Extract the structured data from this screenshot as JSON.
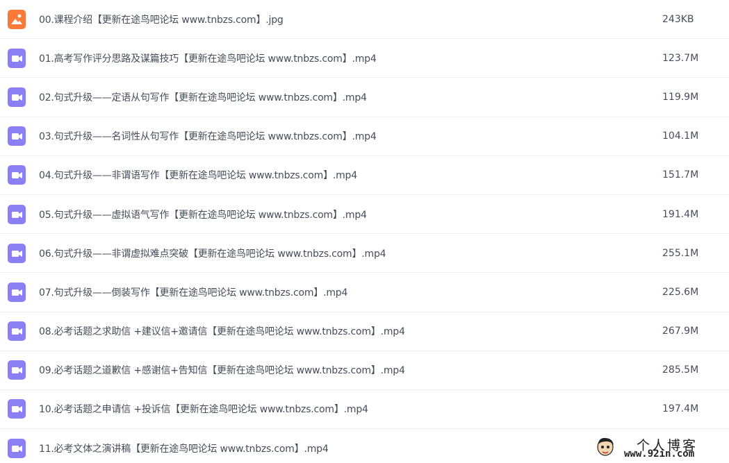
{
  "colors": {
    "image_icon": "#fa7a3a",
    "video_icon": "#8b7ff5",
    "text": "#454d5a",
    "divider": "#f0f0f0"
  },
  "files": [
    {
      "name": "00.课程介绍【更新在途鸟吧论坛 www.tnbzs.com】.jpg",
      "size": "243KB",
      "type": "image",
      "icon": "image-file-icon"
    },
    {
      "name": "01.高考写作评分思路及谋篇技巧【更新在途鸟吧论坛 www.tnbzs.com】.mp4",
      "size": "123.7M",
      "type": "video",
      "icon": "video-file-icon"
    },
    {
      "name": "02.句式升级——定语从句写作【更新在途鸟吧论坛 www.tnbzs.com】.mp4",
      "size": "119.9M",
      "type": "video",
      "icon": "video-file-icon"
    },
    {
      "name": "03.句式升级——名词性从句写作【更新在途鸟吧论坛 www.tnbzs.com】.mp4",
      "size": "104.1M",
      "type": "video",
      "icon": "video-file-icon"
    },
    {
      "name": "04.句式升级——非谓语写作【更新在途鸟吧论坛 www.tnbzs.com】.mp4",
      "size": "151.7M",
      "type": "video",
      "icon": "video-file-icon"
    },
    {
      "name": "05.句式升级——虚拟语气写作【更新在途鸟吧论坛 www.tnbzs.com】.mp4",
      "size": "191.4M",
      "type": "video",
      "icon": "video-file-icon"
    },
    {
      "name": "06.句式升级——非谓虚拟难点突破【更新在途鸟吧论坛 www.tnbzs.com】.mp4",
      "size": "255.1M",
      "type": "video",
      "icon": "video-file-icon"
    },
    {
      "name": "07.句式升级——倒装写作【更新在途鸟吧论坛 www.tnbzs.com】.mp4",
      "size": "225.6M",
      "type": "video",
      "icon": "video-file-icon"
    },
    {
      "name": "08.必考话题之求助信 +建议信+邀请信【更新在途鸟吧论坛 www.tnbzs.com】.mp4",
      "size": "267.9M",
      "type": "video",
      "icon": "video-file-icon"
    },
    {
      "name": "09.必考话题之道歉信 +感谢信+告知信【更新在途鸟吧论坛 www.tnbzs.com】.mp4",
      "size": "285.5M",
      "type": "video",
      "icon": "video-file-icon"
    },
    {
      "name": "10.必考话题之申请信 +投诉信【更新在途鸟吧论坛 www.tnbzs.com】.mp4",
      "size": "197.4M",
      "type": "video",
      "icon": "video-file-icon"
    },
    {
      "name": "11.必考文体之演讲稿【更新在途鸟吧论坛 www.tnbzs.com】.mp4",
      "size": "",
      "type": "video",
      "icon": "video-file-icon"
    }
  ],
  "watermark": {
    "title": "个人博客",
    "url": "www.92in.com"
  }
}
